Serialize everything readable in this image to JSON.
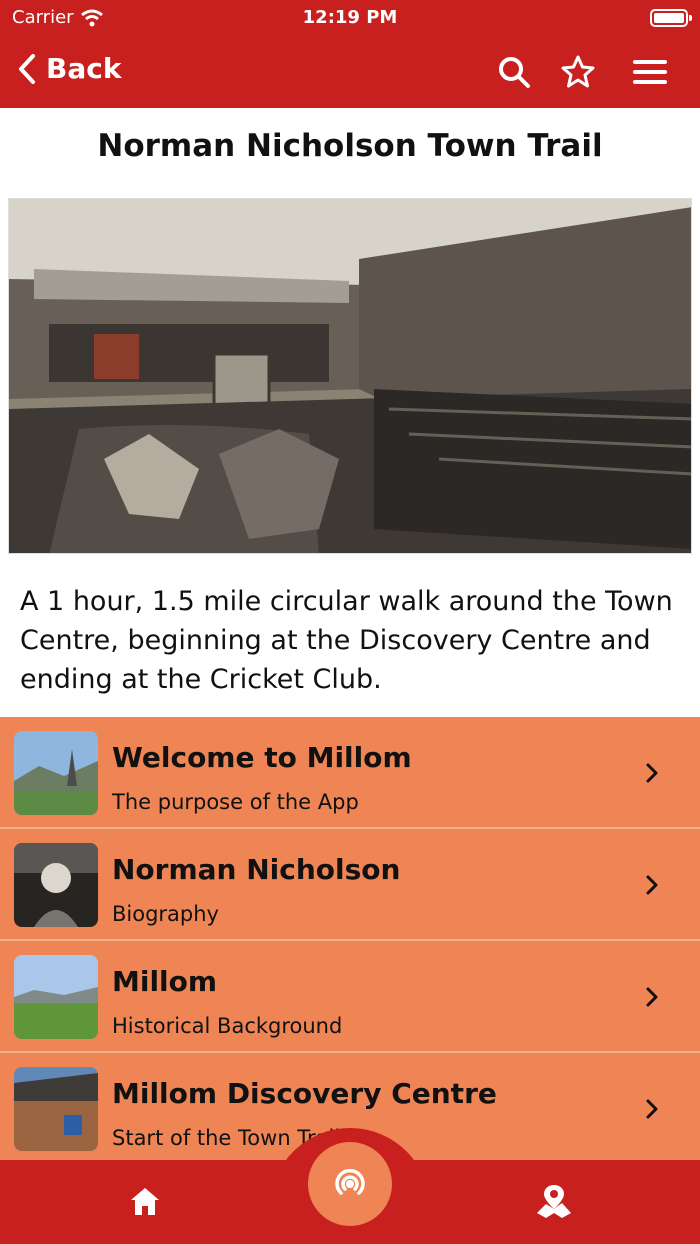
{
  "status": {
    "carrier": "Carrier",
    "time": "12:19 PM"
  },
  "nav": {
    "back_label": "Back"
  },
  "page": {
    "title": "Norman Nicholson Town Trail",
    "description": "A 1 hour, 1.5 mile circular walk around the Town Centre, beginning at the Discovery Centre and ending at the Cricket Club."
  },
  "items": [
    {
      "title": "Welcome to Millom",
      "subtitle": "The purpose of the App"
    },
    {
      "title": "Norman Nicholson",
      "subtitle": "Biography"
    },
    {
      "title": "Millom",
      "subtitle": "Historical Background"
    },
    {
      "title": "Millom Discovery Centre",
      "subtitle": "Start of the Town Trail"
    }
  ],
  "colors": {
    "header_red": "#c8201f",
    "list_orange": "#ef8454",
    "text": "#111111"
  },
  "icons": [
    "wifi-icon",
    "battery-icon",
    "chevron-left-icon",
    "search-icon",
    "star-icon",
    "menu-icon",
    "chevron-right-icon",
    "home-icon",
    "audio-icon",
    "map-icon"
  ]
}
